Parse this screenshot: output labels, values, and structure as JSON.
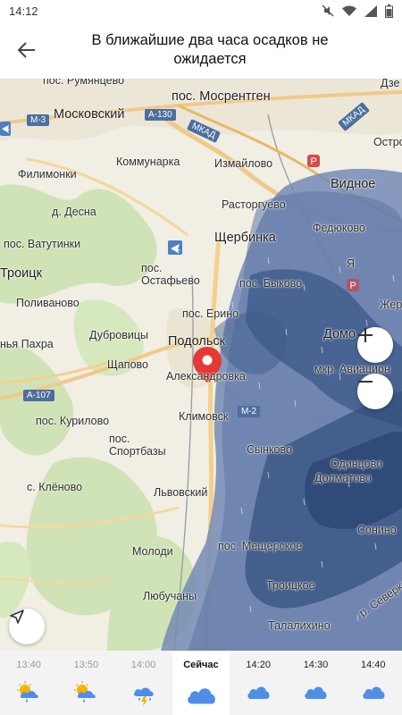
{
  "status_bar": {
    "time": "14:12"
  },
  "header": {
    "title": "В ближайшие два часа осадков не ожидается"
  },
  "map": {
    "labels": {
      "rumyantsevo": "пос. Румянцево",
      "mosrentgen": "пос. Мосрентген",
      "dze": "Дзе",
      "moskovsky": "Московский",
      "kommunarka": "Коммунарка",
      "izmaylovo": "Измайлово",
      "filimonki": "Филимонки",
      "desna": "д. Десна",
      "rastorguevo": "Расторгуево",
      "vidnoe": "Видное",
      "vatutinki": "пос. Ватутинки",
      "shcherbinka": "Щербинка",
      "fedyukovo": "Федюково",
      "troitsk": "Троицк",
      "ostafyevo": "пос.\nОстафьево",
      "bykovo": "пос. Быково",
      "polivanovo": "Поливаново",
      "erino": "пос. Ерино",
      "dubrovitsy": "Дубровицы",
      "domodedovo": "Домо",
      "pakhra": "нья Пахра",
      "podolsk": "Подольск",
      "mkr_aviatsionny": "мкр. Авиацион",
      "shchapovo": "Щапово",
      "aleksandrovka": "Александровка",
      "kurilovo": "пос. Курилово",
      "klimovsk": "Климовск",
      "sportbazy": "пос.\nСпортбазы",
      "synkovo": "Сынково",
      "odintsovo": "Одинцово",
      "klenovo": "с. Клёново",
      "dolmatovo": "Долматово",
      "lvovsky": "Львовский",
      "sonino": "Сонино",
      "molodi": "Молоди",
      "meshcherskoe": "пос. Мещерское",
      "troitskoe": "Троицкое",
      "lyubuchany": "Любучаны",
      "talalikhino": "Талалихино",
      "severka": "р. Северка",
      "ostro": "Остро",
      "zhe": "Жер",
      "ya": "Я"
    },
    "shields": {
      "m3": "M-3",
      "a130": "A-130",
      "mkad": "МКАД",
      "mkad2": "МКАД",
      "a107": "A-107",
      "m2": "M-2"
    },
    "zoom_in": "+",
    "zoom_out": "−"
  },
  "timeline": {
    "slots": [
      {
        "time": "13:40",
        "icon": "sun-cloud-rain-icon"
      },
      {
        "time": "13:50",
        "icon": "sun-cloud-rain-icon"
      },
      {
        "time": "14:00",
        "icon": "cloud-thunder-icon"
      },
      {
        "time": "Сейчас",
        "icon": "cloud-icon"
      },
      {
        "time": "14:20",
        "icon": "cloud-icon"
      },
      {
        "time": "14:30",
        "icon": "cloud-icon"
      },
      {
        "time": "14:40",
        "icon": "cloud-icon"
      }
    ]
  },
  "colors": {
    "precip_light": "#6f87b4",
    "precip_dark": "#324e7d",
    "cloud_blue": "#4f8ee6",
    "accent_red": "#e53935"
  }
}
